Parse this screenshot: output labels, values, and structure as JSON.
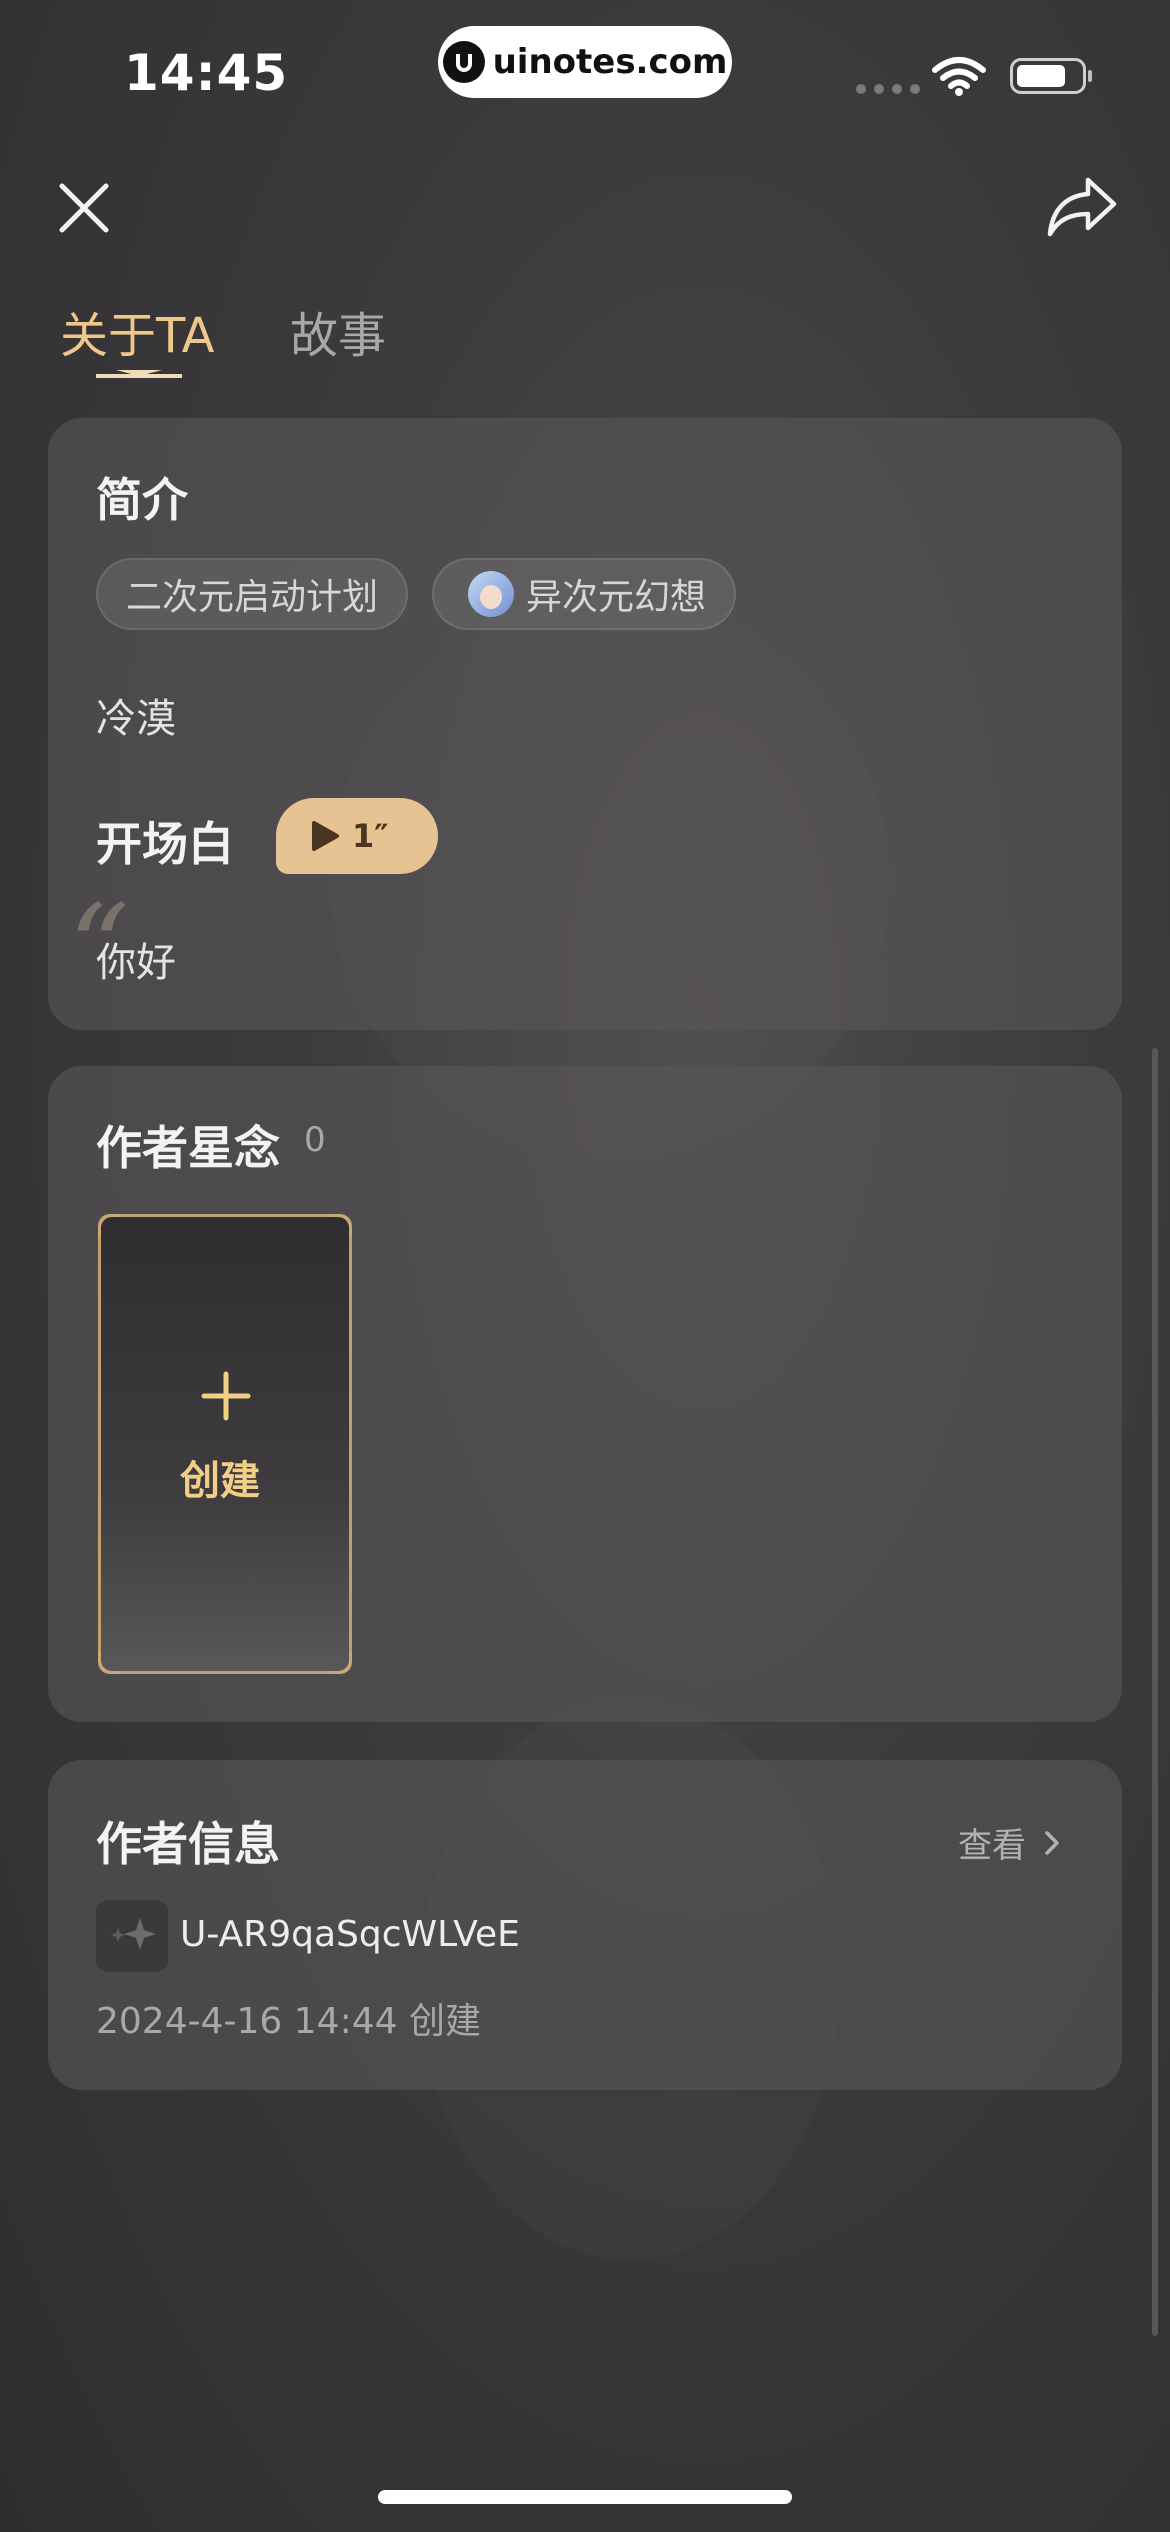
{
  "status_bar": {
    "time": "14:45",
    "url": "uinotes.com"
  },
  "header": {
    "tabs": [
      {
        "label": "关于TA",
        "active": true
      },
      {
        "label": "故事",
        "active": false
      }
    ],
    "accent_color": "#eec88a"
  },
  "intro": {
    "title": "简介",
    "tags": [
      "二次元启动计划",
      "异次元幻想"
    ],
    "description": "冷漠",
    "opening_label": "开场白",
    "voice_duration": "1″",
    "greeting": "你好"
  },
  "memories": {
    "title": "作者星念",
    "count": "0",
    "create_label": "创建"
  },
  "author": {
    "title": "作者信息",
    "view_label": "查看",
    "user_id": "U-AR9qaSqcWLVeE",
    "created": "2024-4-16 14:44 创建"
  }
}
